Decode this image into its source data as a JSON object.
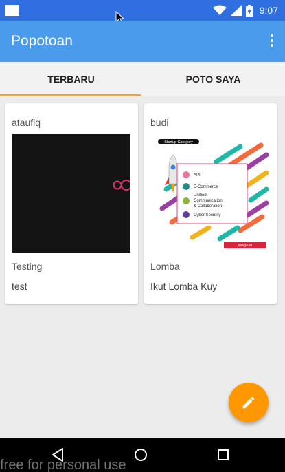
{
  "status_bar": {
    "time": "9:07",
    "icons": [
      "notification-icon",
      "wifi-icon",
      "signal-icon",
      "battery-icon"
    ]
  },
  "app_bar": {
    "title": "Popotoan",
    "menu_icon": "more-vert-icon"
  },
  "tabs": [
    {
      "label": "TERBARU",
      "selected": true
    },
    {
      "label": "POTO SAYA",
      "selected": false
    }
  ],
  "posts": [
    {
      "author": "ataufiq",
      "caption": "Testing",
      "description": "test"
    },
    {
      "author": "budi",
      "caption": "Lomba",
      "description": "Ikut Lomba Kuy",
      "poster": {
        "heading": "Startup Category",
        "items": [
          "API",
          "E-Commerce",
          "Unified",
          "Communication",
          "& Collaboration",
          "Cyber Security"
        ],
        "footer": "indigo.id"
      }
    }
  ],
  "fab": {
    "icon": "edit-icon"
  },
  "nav": {
    "icons": [
      "back-icon",
      "home-icon",
      "recents-icon"
    ]
  },
  "watermark": "free for personal use",
  "colors": {
    "status_bar": "#2f6fe0",
    "app_bar": "#4a9bec",
    "accent": "#ff9800",
    "tab_indicator": "#ff9d1c"
  }
}
